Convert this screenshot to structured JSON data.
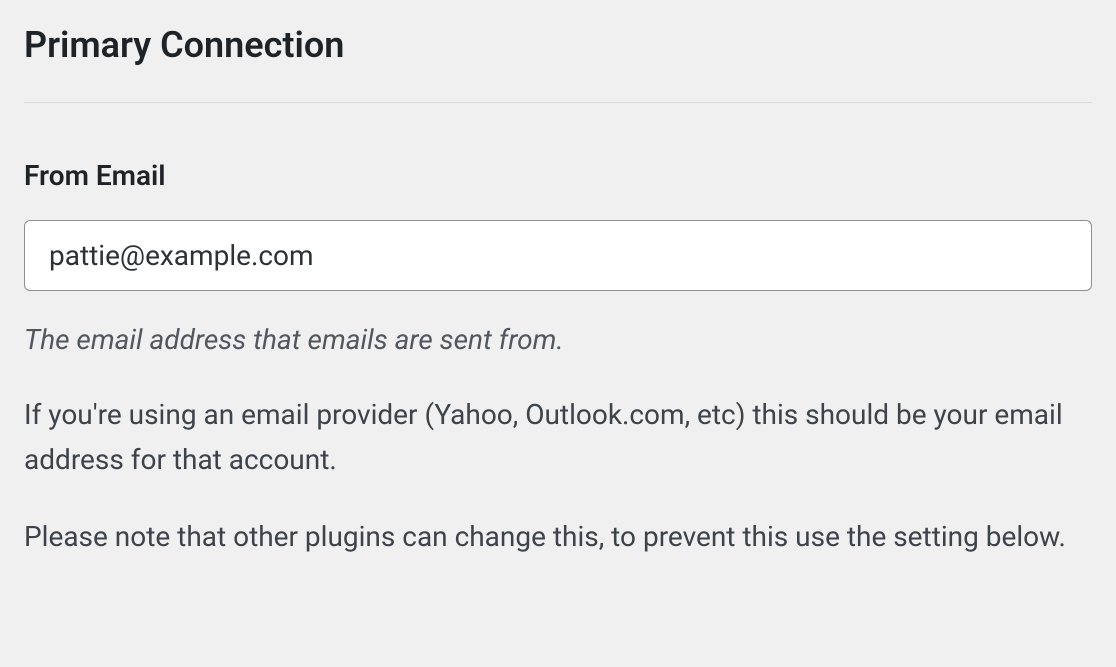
{
  "section": {
    "title": "Primary Connection"
  },
  "fromEmail": {
    "label": "From Email",
    "value": "pattie@example.com",
    "helpItalic": "The email address that emails are sent from.",
    "help1": "If you're using an email provider (Yahoo, Outlook.com, etc) this should be your email address for that account.",
    "help2": "Please note that other plugins can change this, to prevent this use the setting below."
  }
}
